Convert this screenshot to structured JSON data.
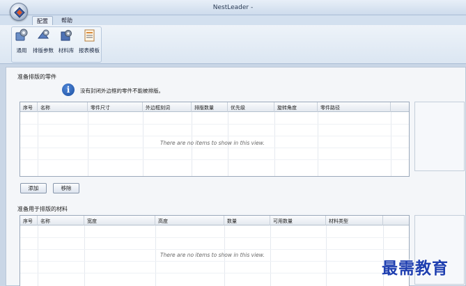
{
  "window": {
    "title": "NestLeader -"
  },
  "ribbon": {
    "tabs": [
      {
        "label": "配置",
        "active": true
      },
      {
        "label": "帮助",
        "active": false
      }
    ],
    "buttons": [
      {
        "label": "通用",
        "icon": "gear-settings-icon"
      },
      {
        "label": "排版参数",
        "icon": "nest-params-icon"
      },
      {
        "label": "材料库",
        "icon": "material-library-icon"
      },
      {
        "label": "报表模板",
        "icon": "report-template-icon"
      }
    ]
  },
  "parts_section": {
    "title": "准备排版的零件",
    "info_text": "没有封闭外边框的零件不能被排版。",
    "columns": [
      "序号",
      "名称",
      "零件尺寸",
      "外边框刻词",
      "排版数量",
      "优先级",
      "旋转角度",
      "零件路径"
    ],
    "empty_message": "There are no items to show in this view.",
    "add_button": "添加",
    "remove_button": "移除"
  },
  "materials_section": {
    "title": "准备用于排版的材料",
    "columns": [
      "序号",
      "名称",
      "宽度",
      "高度",
      "数量",
      "可用数量",
      "材料类型"
    ],
    "empty_message": "There are no items to show in this view."
  },
  "watermark": "最需教育",
  "colors": {
    "accent": "#1b4fa0",
    "watermark": "#1f3fb0"
  }
}
